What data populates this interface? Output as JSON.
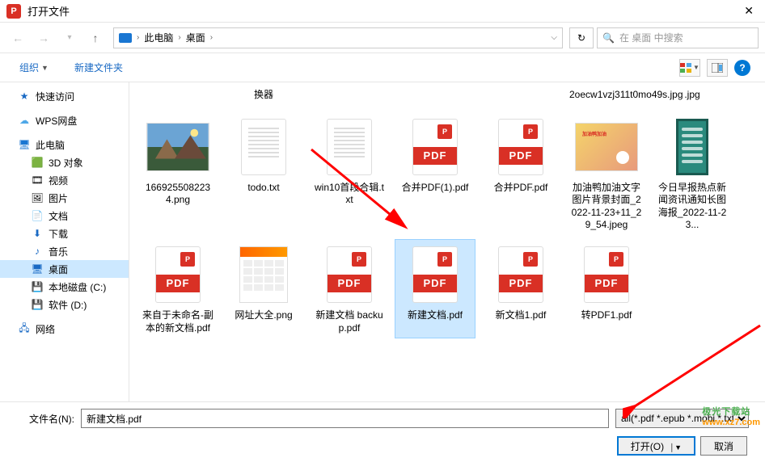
{
  "titlebar": {
    "title": "打开文件"
  },
  "breadcrumb": {
    "root": "此电脑",
    "folder": "桌面"
  },
  "search": {
    "placeholder": "在 桌面 中搜索"
  },
  "toolbar": {
    "organize": "组织",
    "newfolder": "新建文件夹"
  },
  "sidebar": {
    "quick_access": "快速访问",
    "wps": "WPS网盘",
    "this_pc": "此电脑",
    "objects_3d": "3D 对象",
    "videos": "视频",
    "pictures": "图片",
    "documents": "文档",
    "downloads": "下载",
    "music": "音乐",
    "desktop": "桌面",
    "local_c": "本地磁盘 (C:)",
    "software_d": "软件 (D:)",
    "network": "网络"
  },
  "files": {
    "row0_label1": "换器",
    "row0_label2": "2oecw1vzj311t0mo49s.jpg",
    "row0_label3": ".jpg",
    "landscape_png": "1669255082234.png",
    "todo_txt": "todo.txt",
    "win10_txt": "win10首段合辑.txt",
    "merge_pdf1": "合并PDF(1).pdf",
    "merge_pdf": "合并PDF.pdf",
    "duck_jpeg": "加油鸭加油文字图片背景封面_2022-11-23+11_29_54.jpeg",
    "news_img": "今日早报热点新闻资讯通知长图海报_2022-11-23...",
    "unnamed_pdf": "来自于未命名-副本的新文档.pdf",
    "web_png": "网址大全.png",
    "newdoc_backup": "新建文档 backup.pdf",
    "newdoc": "新建文档.pdf",
    "newdoc1": "新文档1.pdf",
    "convert_pdf1": "转PDF1.pdf"
  },
  "footer": {
    "filename_label": "文件名(N):",
    "filename_value": "新建文档.pdf",
    "filter": "all(*.pdf *.epub *.mobi *.txt *",
    "open_btn": "打开(O)",
    "cancel_btn": "取消"
  },
  "watermark": {
    "cn": "极光下载站",
    "dom": "www.xz7.com"
  }
}
